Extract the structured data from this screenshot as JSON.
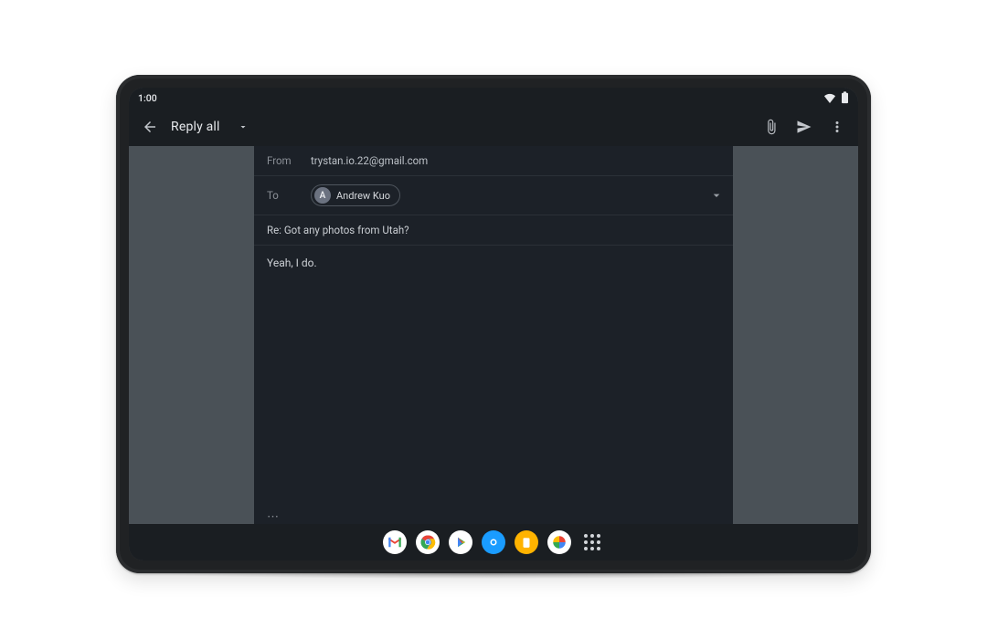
{
  "status": {
    "time": "1:00"
  },
  "appbar": {
    "title": "Reply all"
  },
  "compose": {
    "from_label": "From",
    "from_value": "trystan.io.22@gmail.com",
    "to_label": "To",
    "recipient_initial": "A",
    "recipient_name": "Andrew Kuo",
    "subject": "Re: Got any photos from Utah?",
    "body": "Yeah, I do.",
    "quoted_toggle": "⋯"
  },
  "dock": {
    "apps": [
      "gmail",
      "chrome",
      "play-store",
      "camera",
      "files",
      "photos",
      "all-apps"
    ]
  }
}
